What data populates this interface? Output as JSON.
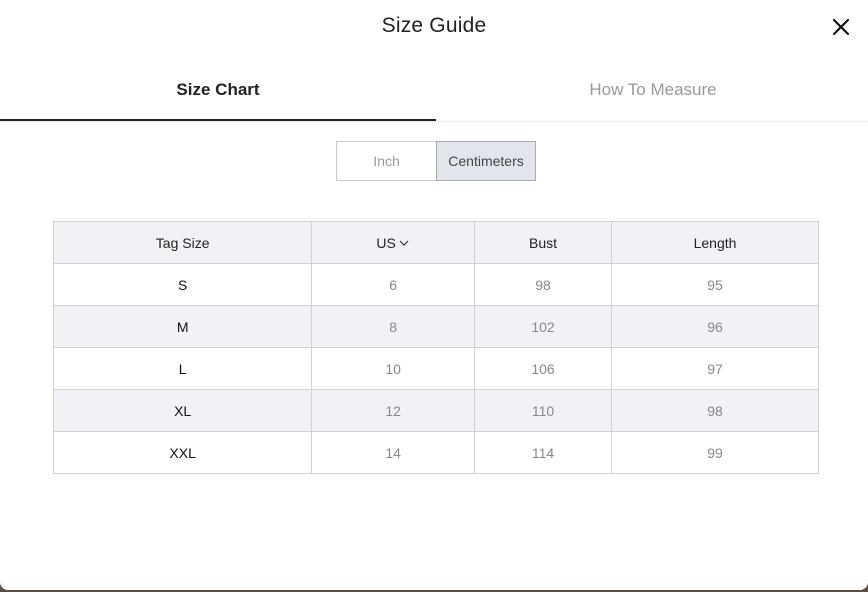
{
  "modal": {
    "title": "Size Guide",
    "close_icon": "close-icon"
  },
  "tabs": [
    {
      "label": "Size Chart",
      "active": true
    },
    {
      "label": "How To Measure",
      "active": false
    }
  ],
  "unit_toggle": {
    "options": [
      "Inch",
      "Centimeters"
    ],
    "selected": "Centimeters"
  },
  "table": {
    "headers": [
      "Tag Size",
      "US",
      "Bust",
      "Length"
    ],
    "us_dropdown_icon": "chevron-down-icon",
    "rows": [
      [
        "S",
        "6",
        "98",
        "95"
      ],
      [
        "M",
        "8",
        "102",
        "96"
      ],
      [
        "L",
        "10",
        "106",
        "97"
      ],
      [
        "XL",
        "12",
        "110",
        "98"
      ],
      [
        "XXL",
        "14",
        "114",
        "99"
      ]
    ]
  }
}
